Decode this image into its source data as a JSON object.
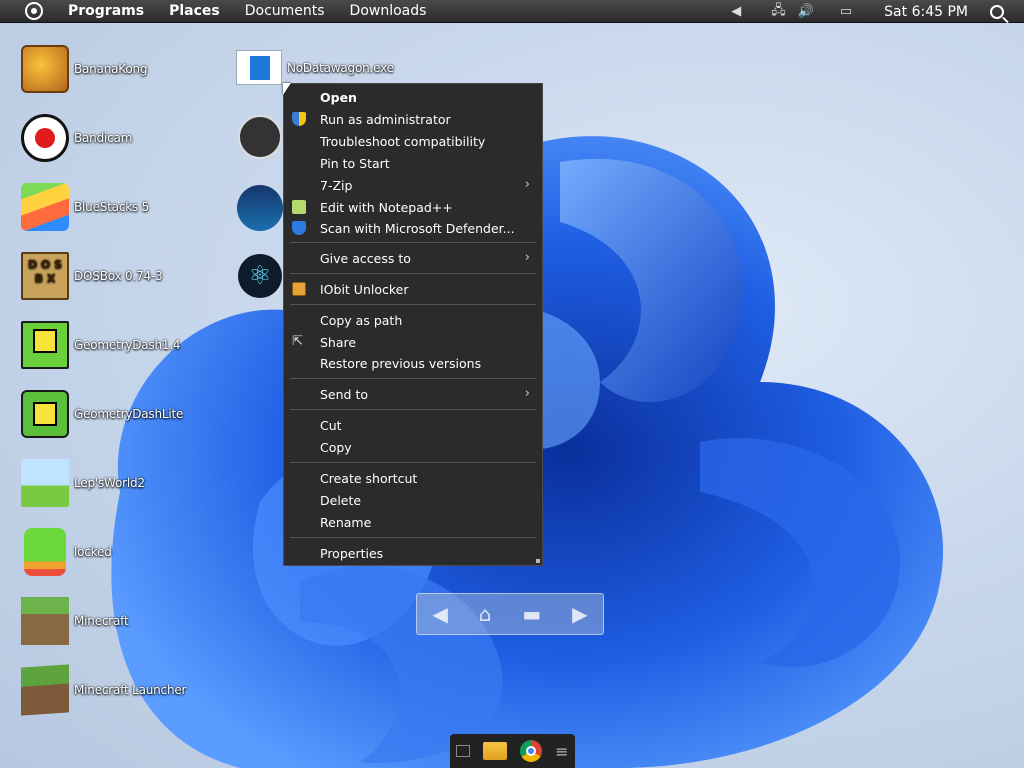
{
  "topbar": {
    "menus": [
      "Programs",
      "Places",
      "Documents",
      "Downloads"
    ],
    "clock": "Sat 6:45 PM"
  },
  "desktop": {
    "left_icons": [
      {
        "label": "BananaKong",
        "icon": "banana-kong-icon"
      },
      {
        "label": "Bandicam",
        "icon": "bandicam-icon"
      },
      {
        "label": "BlueStacks 5",
        "icon": "bluestacks-icon"
      },
      {
        "label": "DOSBox 0.74-3",
        "icon": "dosbox-icon"
      },
      {
        "label": "GeometryDash1.4",
        "icon": "geometry-dash-hack-icon"
      },
      {
        "label": "GeometryDashLite",
        "icon": "geometry-dash-lite-icon"
      },
      {
        "label": "Lep'sWorld2",
        "icon": "leps-world-icon"
      },
      {
        "label": "locked",
        "icon": "locked-app-icon"
      },
      {
        "label": "Minecraft",
        "icon": "minecraft-icon"
      },
      {
        "label": "Minecraft Launcher",
        "icon": "minecraft-launcher-icon"
      }
    ],
    "selected_file": {
      "label": "NoDatawagon.exe",
      "icon": "exe-file-icon"
    }
  },
  "context_menu": {
    "items": [
      {
        "label": "Open"
      },
      {
        "label": "Run as administrator",
        "icon": "shield-icon"
      },
      {
        "label": "Troubleshoot compatibility"
      },
      {
        "label": "Pin to Start"
      },
      {
        "label": "7-Zip",
        "submenu": true
      },
      {
        "label": "Edit with Notepad++",
        "icon": "notepad-plus-icon"
      },
      {
        "label": "Scan with Microsoft Defender...",
        "icon": "defender-icon"
      },
      {
        "label": "Give access to",
        "submenu": true
      },
      {
        "label": "IObit Unlocker",
        "icon": "unlock-icon"
      },
      {
        "label": "Copy as path"
      },
      {
        "label": "Share",
        "icon": "share-icon"
      },
      {
        "label": "Restore previous versions"
      },
      {
        "label": "Send to",
        "submenu": true
      },
      {
        "label": "Cut"
      },
      {
        "label": "Copy"
      },
      {
        "label": "Create shortcut"
      },
      {
        "label": "Delete"
      },
      {
        "label": "Rename"
      },
      {
        "label": "Properties"
      }
    ]
  },
  "colors": {
    "menu_bg": "#2b2b2b",
    "wallpaper_blue": "#1e5bd8"
  }
}
